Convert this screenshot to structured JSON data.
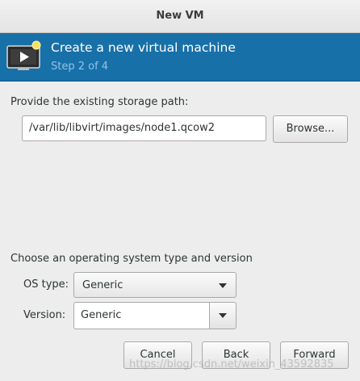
{
  "window": {
    "title": "New VM"
  },
  "banner": {
    "icon": "monitor-play-icon",
    "title": "Create a new virtual machine",
    "step": "Step 2 of 4"
  },
  "storage": {
    "label": "Provide the existing storage path:",
    "path_value": "/var/lib/libvirt/images/node1.qcow2",
    "browse_label": "Browse..."
  },
  "os": {
    "section_label": "Choose an operating system type and version",
    "type_label": "OS type:",
    "type_value": "Generic",
    "version_label": "Version:",
    "version_value": "Generic"
  },
  "buttons": {
    "cancel": "Cancel",
    "back": "Back",
    "forward": "Forward"
  },
  "watermark": "https://blog.csdn.net/weixin_43592835",
  "colors": {
    "banner_bg": "#1870a8",
    "banner_step": "#8ec3ec",
    "window_bg": "#ededed"
  }
}
